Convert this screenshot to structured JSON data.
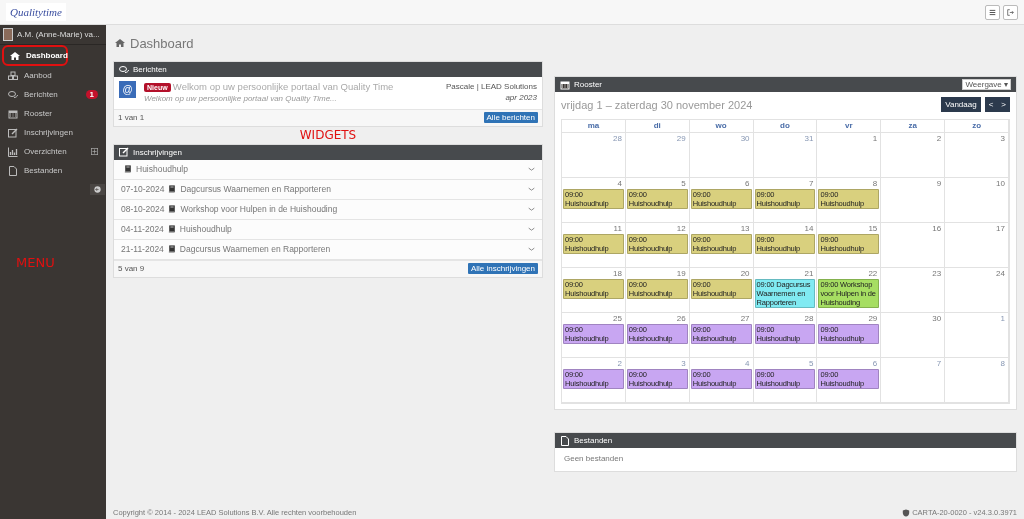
{
  "topbar": {
    "logo": "Qualitytime"
  },
  "sidebar": {
    "user": "A.M. (Anne-Marie) va...",
    "items": [
      {
        "label": "Dashboard",
        "selected": true,
        "circled": true
      },
      {
        "label": "Aanbod",
        "selected": false,
        "circled": false
      },
      {
        "label": "Berichten",
        "selected": false,
        "circled": false,
        "badge": "1"
      },
      {
        "label": "Rooster",
        "selected": false,
        "circled": false
      },
      {
        "label": "Inschrijvingen",
        "selected": false,
        "circled": false
      },
      {
        "label": "Overzichten",
        "selected": false,
        "circled": false,
        "expandable": true
      },
      {
        "label": "Bestanden",
        "selected": false,
        "circled": false
      }
    ]
  },
  "annotations": {
    "menu": "MENU",
    "widgets": "WIDGETS"
  },
  "page_title": "Dashboard",
  "berichten": {
    "title": "Berichten",
    "messages": [
      {
        "symbol": "@",
        "badge": "Nieuw",
        "subject": "Welkom op uw persoonlijke portaal van Quality Time",
        "preview": "Welkom op uw persoonlijke portaal van Quality Time...",
        "sender": "Pascale | LEAD Solutions",
        "date": "apr 2023"
      }
    ],
    "count": "1 van 1",
    "button": "Alle berichten"
  },
  "inschrijvingen": {
    "title": "Inschrijvingen",
    "rows": [
      {
        "name": "Huishoudhulp"
      },
      {
        "date": "07-10-2024",
        "name": "Dagcursus Waarnemen en Rapporteren"
      },
      {
        "date": "08-10-2024",
        "name": "Workshop voor Hulpen in de Huishouding"
      },
      {
        "date": "04-11-2024",
        "name": "Huishoudhulp"
      },
      {
        "date": "21-11-2024",
        "name": "Dagcursus Waarnemen en Rapporteren"
      }
    ],
    "count": "5 van 9",
    "button": "Alle inschrijvingen"
  },
  "rooster": {
    "title": "Rooster",
    "view_button": "Weergave ▾",
    "range": "vrijdag 1 – zaterdag 30 november 2024",
    "today_button": "Vandaag",
    "prev": "<",
    "next": ">",
    "weekdays": [
      "ma",
      "di",
      "wo",
      "do",
      "vr",
      "za",
      "zo"
    ],
    "weeks": [
      {
        "days": [
          {
            "day": "28",
            "other_month": true
          },
          {
            "day": "29",
            "other_month": true
          },
          {
            "day": "30",
            "other_month": true
          },
          {
            "day": "31",
            "other_month": true
          },
          {
            "day": "1",
            "other_month": false
          },
          {
            "day": "2",
            "other_month": false
          },
          {
            "day": "3",
            "other_month": false
          }
        ]
      },
      {
        "days": [
          {
            "day": "4",
            "other_month": false,
            "events": [
              {
                "text": "09:00 Huishoudhulp",
                "color": "#d9d07e"
              }
            ]
          },
          {
            "day": "5",
            "other_month": false,
            "events": [
              {
                "text": "09:00 Huishoudhulp",
                "color": "#d9d07e"
              }
            ]
          },
          {
            "day": "6",
            "other_month": false,
            "events": [
              {
                "text": "09:00 Huishoudhulp",
                "color": "#d9d07e"
              }
            ]
          },
          {
            "day": "7",
            "other_month": false,
            "events": [
              {
                "text": "09:00 Huishoudhulp",
                "color": "#d9d07e"
              }
            ]
          },
          {
            "day": "8",
            "other_month": false,
            "events": [
              {
                "text": "09:00 Huishoudhulp",
                "color": "#d9d07e"
              }
            ]
          },
          {
            "day": "9",
            "other_month": false
          },
          {
            "day": "10",
            "other_month": false
          }
        ]
      },
      {
        "days": [
          {
            "day": "11",
            "other_month": false,
            "events": [
              {
                "text": "09:00 Huishoudhulp",
                "color": "#d9d07e"
              }
            ]
          },
          {
            "day": "12",
            "other_month": false,
            "events": [
              {
                "text": "09:00 Huishoudhulp",
                "color": "#d9d07e"
              }
            ]
          },
          {
            "day": "13",
            "other_month": false,
            "events": [
              {
                "text": "09:00 Huishoudhulp",
                "color": "#d9d07e"
              }
            ]
          },
          {
            "day": "14",
            "other_month": false,
            "events": [
              {
                "text": "09:00 Huishoudhulp",
                "color": "#d9d07e"
              }
            ]
          },
          {
            "day": "15",
            "other_month": false,
            "events": [
              {
                "text": "09:00 Huishoudhulp",
                "color": "#d9d07e"
              }
            ]
          },
          {
            "day": "16",
            "other_month": false
          },
          {
            "day": "17",
            "other_month": false
          }
        ]
      },
      {
        "days": [
          {
            "day": "18",
            "other_month": false,
            "events": [
              {
                "text": "09:00 Huishoudhulp",
                "color": "#d9d07e"
              }
            ]
          },
          {
            "day": "19",
            "other_month": false,
            "events": [
              {
                "text": "09:00 Huishoudhulp",
                "color": "#d9d07e"
              }
            ]
          },
          {
            "day": "20",
            "other_month": false,
            "events": [
              {
                "text": "09:00 Huishoudhulp",
                "color": "#d9d07e"
              }
            ]
          },
          {
            "day": "21",
            "other_month": false,
            "events": [
              {
                "text": "09:00 Dagcursus Waarnemen en Rapporteren",
                "color": "#80eaf2"
              }
            ]
          },
          {
            "day": "22",
            "other_month": false,
            "events": [
              {
                "text": "09:00 Workshop voor Hulpen in de Huishouding",
                "color": "#a6de62"
              }
            ]
          },
          {
            "day": "23",
            "other_month": false
          },
          {
            "day": "24",
            "other_month": false
          }
        ]
      },
      {
        "days": [
          {
            "day": "25",
            "other_month": false,
            "events": [
              {
                "text": "09:00 Huishoudhulp",
                "color": "#c8a6f2"
              }
            ]
          },
          {
            "day": "26",
            "other_month": false,
            "events": [
              {
                "text": "09:00 Huishoudhulp",
                "color": "#c8a6f2"
              }
            ]
          },
          {
            "day": "27",
            "other_month": false,
            "events": [
              {
                "text": "09:00 Huishoudhulp",
                "color": "#c8a6f2"
              }
            ]
          },
          {
            "day": "28",
            "other_month": false,
            "events": [
              {
                "text": "09:00 Huishoudhulp",
                "color": "#c8a6f2"
              }
            ]
          },
          {
            "day": "29",
            "other_month": false,
            "events": [
              {
                "text": "09:00 Huishoudhulp",
                "color": "#c8a6f2"
              }
            ]
          },
          {
            "day": "30",
            "other_month": false
          },
          {
            "day": "1",
            "other_month": true
          }
        ]
      },
      {
        "days": [
          {
            "day": "2",
            "other_month": true,
            "events": [
              {
                "text": "09:00 Huishoudhulp",
                "color": "#c8a6f2"
              }
            ]
          },
          {
            "day": "3",
            "other_month": true,
            "events": [
              {
                "text": "09:00 Huishoudhulp",
                "color": "#c8a6f2"
              }
            ]
          },
          {
            "day": "4",
            "other_month": true,
            "events": [
              {
                "text": "09:00 Huishoudhulp",
                "color": "#c8a6f2"
              }
            ]
          },
          {
            "day": "5",
            "other_month": true,
            "events": [
              {
                "text": "09:00 Huishoudhulp",
                "color": "#c8a6f2"
              }
            ]
          },
          {
            "day": "6",
            "other_month": true,
            "events": [
              {
                "text": "09:00 Huishoudhulp",
                "color": "#c8a6f2"
              }
            ]
          },
          {
            "day": "7",
            "other_month": true
          },
          {
            "day": "8",
            "other_month": true
          }
        ]
      }
    ]
  },
  "bestanden": {
    "title": "Bestanden",
    "empty": "Geen bestanden"
  },
  "footer": {
    "copyright": "Copyright © 2014 - 2024 LEAD Solutions B.V. Alle rechten voorbehouden",
    "version": "CARTA-20-0020 - v24.3.0.3971"
  }
}
